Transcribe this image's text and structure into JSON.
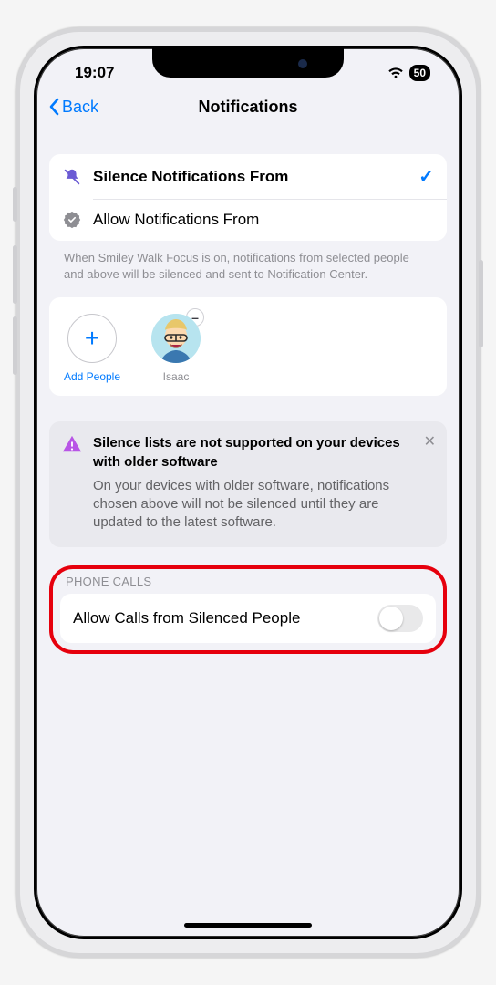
{
  "status": {
    "time": "19:07",
    "battery": "50"
  },
  "nav": {
    "back": "Back",
    "title": "Notifications"
  },
  "options": {
    "silence": "Silence Notifications From",
    "allow": "Allow Notifications From",
    "footer": "When Smiley Walk Focus is on, notifications from selected people and above will be silenced and sent to Notification Center."
  },
  "people": {
    "add": "Add People",
    "items": [
      {
        "name": "Isaac"
      }
    ]
  },
  "info": {
    "title": "Silence lists are not supported on your devices with older software",
    "body": "On your devices with older software, notifications chosen above will not be silenced until they are updated to the latest software."
  },
  "calls": {
    "header": "PHONE CALLS",
    "label": "Allow Calls from Silenced People",
    "enabled": false
  }
}
